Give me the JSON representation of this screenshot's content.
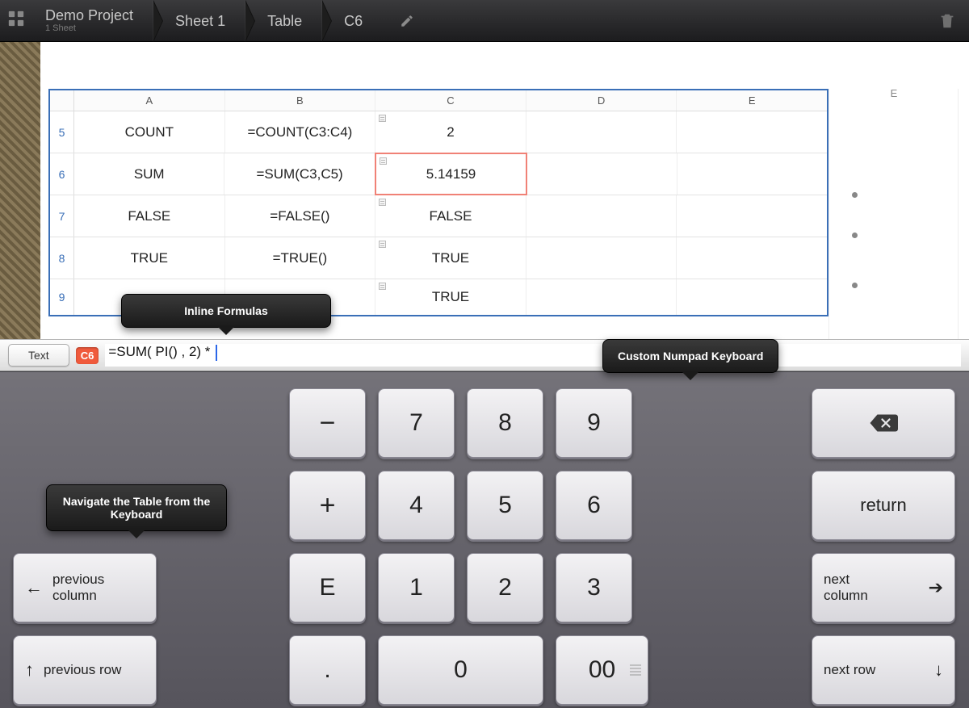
{
  "breadcrumbs": {
    "project_title": "Demo Project",
    "project_sub": "1 Sheet",
    "sheet": "Sheet 1",
    "object": "Table",
    "cell": "C6"
  },
  "columns": [
    "A",
    "B",
    "C",
    "D",
    "E"
  ],
  "ghost_col_label": "E",
  "rows": [
    {
      "num": "5",
      "A": "COUNT",
      "B": "=COUNT(C3:C4)",
      "C": "2",
      "cf": true
    },
    {
      "num": "6",
      "A": "SUM",
      "B": "=SUM(C3,C5)",
      "C": "5.14159",
      "cf": true,
      "sel": true
    },
    {
      "num": "7",
      "A": "FALSE",
      "B": "=FALSE()",
      "C": "FALSE",
      "cf": true
    },
    {
      "num": "8",
      "A": "TRUE",
      "B": "=TRUE()",
      "C": "TRUE",
      "cf": true
    },
    {
      "num": "9",
      "A": "",
      "B": "",
      "C": "TRUE",
      "cf": true
    }
  ],
  "formula_bar": {
    "mode_button": "Text",
    "cell_ref": "C6",
    "formula": "=SUM( PI() , 2) * "
  },
  "tooltips": {
    "inline": "Inline Formulas",
    "numpad": "Custom Numpad Keyboard",
    "navigate": "Navigate the Table from the Keyboard"
  },
  "keys": {
    "minus": "−",
    "plus": "+",
    "E": "E",
    "dot": ".",
    "k7": "7",
    "k8": "8",
    "k9": "9",
    "k4": "4",
    "k5": "5",
    "k6": "6",
    "k1": "1",
    "k2": "2",
    "k3": "3",
    "k0": "0",
    "k00": "00",
    "return": "return",
    "prev_col": "previous column",
    "prev_row": "previous row",
    "next_col": "next column",
    "next_row": "next row"
  }
}
